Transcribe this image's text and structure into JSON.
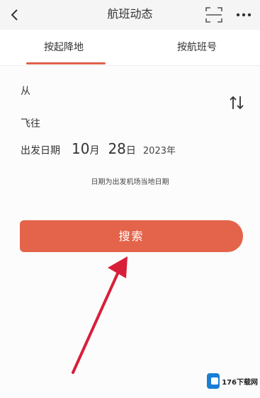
{
  "header": {
    "title": "航班动态",
    "back_icon": "chevron-left-icon",
    "scan_icon": "scan-icon",
    "more_icon": "more-dots-icon"
  },
  "tabs": [
    {
      "label": "按起降地",
      "active": true
    },
    {
      "label": "按航班号",
      "active": false
    }
  ],
  "form": {
    "from_label": "从",
    "to_label": "飞往",
    "swap_icon": "swap-icon",
    "date": {
      "label": "出发日期",
      "month": "10",
      "month_unit": "月",
      "day": "28",
      "day_unit": "日",
      "year": "2023年"
    },
    "hint": "日期为出发机场当地日期",
    "search_label": "搜索"
  },
  "colors": {
    "accent": "#e4644b",
    "annotation_arrow": "#d81f3a"
  },
  "watermark": {
    "text": "176下载网"
  }
}
